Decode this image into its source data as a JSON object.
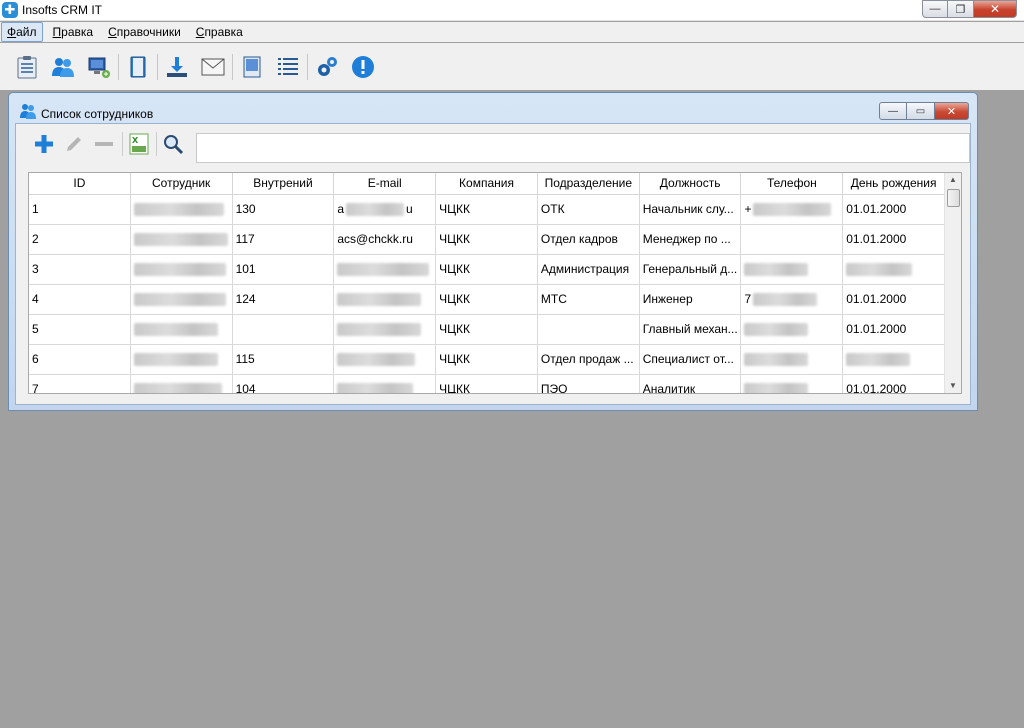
{
  "app": {
    "title": "Insofts CRM IT",
    "logo_glyph": "✚",
    "window_buttons": {
      "minimize": "—",
      "maximize": "❐",
      "close": "✕"
    }
  },
  "menu": [
    {
      "label": "Файл",
      "active": true
    },
    {
      "label": "Правка",
      "active": false
    },
    {
      "label": "Справочники",
      "active": false
    },
    {
      "label": "Справка",
      "active": false
    }
  ],
  "toolbar": {
    "buttons": [
      {
        "icon": "clipboard-list-icon"
      },
      {
        "icon": "users-icon"
      },
      {
        "icon": "computer-network-icon"
      },
      {
        "icon": "book-icon"
      },
      {
        "icon": "download-icon"
      },
      {
        "icon": "envelope-icon"
      },
      {
        "icon": "document-icon"
      },
      {
        "icon": "list-icon"
      },
      {
        "icon": "gears-icon"
      },
      {
        "icon": "info-icon"
      }
    ]
  },
  "child_window": {
    "title": "Список сотрудников",
    "buttons": {
      "minimize": "—",
      "maximize": "▭",
      "close": "✕"
    },
    "toolbar": {
      "add": "add-icon",
      "edit": "edit-icon",
      "remove": "remove-icon",
      "export_csv": "csv-export-icon",
      "search": "search-icon"
    },
    "search": {
      "value": "",
      "placeholder": ""
    },
    "columns": [
      "ID",
      "Сотрудник",
      "Внутрений",
      "E-mail",
      "Компания",
      "Подразделение",
      "Должность",
      "Телефон",
      "День рождения"
    ],
    "rows": [
      {
        "id": "1",
        "emp": "",
        "ext": "130",
        "mail": "a",
        "mail_tail": "u",
        "comp": "ЧЦКК",
        "dept": "ОТК",
        "pos": "Начальник слу...",
        "phone": "+",
        "bday": "01.01.2000"
      },
      {
        "id": "2",
        "emp": "",
        "ext": "117",
        "mail": "acs@chckk.ru",
        "mail_tail": "",
        "comp": "ЧЦКК",
        "dept": "Отдел кадров",
        "pos": "Менеджер по ...",
        "phone": "",
        "bday": "01.01.2000"
      },
      {
        "id": "3",
        "emp": "",
        "ext": "101",
        "mail": "",
        "mail_tail": "",
        "comp": "ЧЦКК",
        "dept": "Администрация",
        "pos": "Генеральный д...",
        "phone": "",
        "bday": ""
      },
      {
        "id": "4",
        "emp": "",
        "ext": "124",
        "mail": "",
        "mail_tail": "",
        "comp": "ЧЦКК",
        "dept": "МТС",
        "pos": "Инженер",
        "phone": "7",
        "bday": "01.01.2000"
      },
      {
        "id": "5",
        "emp": "",
        "ext": "",
        "mail": "",
        "mail_tail": "",
        "comp": "ЧЦКК",
        "dept": "",
        "pos": "Главный механ...",
        "phone": "",
        "bday": "01.01.2000"
      },
      {
        "id": "6",
        "emp": "",
        "ext": "115",
        "mail": "",
        "mail_tail": "",
        "comp": "ЧЦКК",
        "dept": "Отдел продаж ...",
        "pos": "Специалист от...",
        "phone": "",
        "bday": ""
      },
      {
        "id": "7",
        "emp": "",
        "ext": "104",
        "mail": "",
        "mail_tail": "",
        "comp": "ЧЦКК",
        "dept": "ПЭО",
        "pos": "Аналитик",
        "phone": "",
        "bday": "01.01.2000"
      }
    ]
  },
  "colors": {
    "mdi_background": "#a0a0a0",
    "accent_blue": "#1e7ed8",
    "close_red": "#c7422d"
  }
}
